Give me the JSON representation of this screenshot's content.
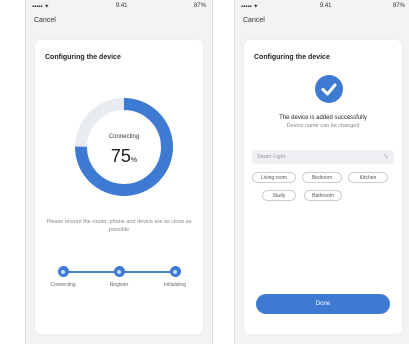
{
  "colors": {
    "accent": "#3f7ad2",
    "track": "#e8ecf1"
  },
  "left": {
    "status": {
      "carrier": "▪▪▪▪▪ ✦",
      "time": "9:41",
      "battery": "87%"
    },
    "nav_back": "Cancel",
    "title": "Configuring the device",
    "progress": {
      "label": "Connecting",
      "value": "75",
      "unit": "%",
      "fraction": 0.75
    },
    "hint": "Please ensure the router, phone and device are as close as possible",
    "steps": [
      "Connecting",
      "Register",
      "Initializing"
    ]
  },
  "right": {
    "status": {
      "carrier": "▪▪▪▪▪ ✦",
      "time": "9:41",
      "battery": "87%"
    },
    "nav_back": "Cancel",
    "title": "Configuring the device",
    "check_icon": "check-circle-icon",
    "success_title": "The device is added successfully",
    "success_sub": "Device name can be changed",
    "name_placeholder": "Smart Light",
    "chips": [
      "Living room",
      "Bedroom",
      "Kitchen",
      "Study",
      "Bathroom"
    ],
    "done_label": "Done"
  }
}
